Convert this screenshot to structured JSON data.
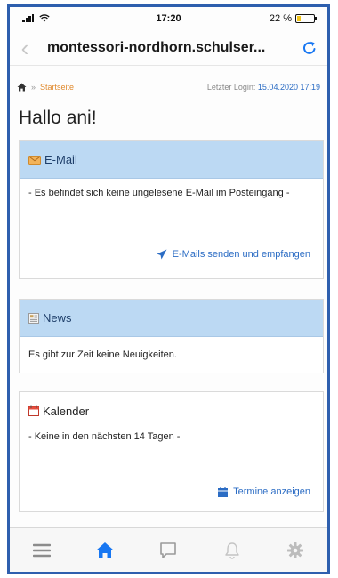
{
  "status_bar": {
    "time": "17:20",
    "battery_text": "22 %",
    "battery_level": 0.22
  },
  "browser": {
    "url": "montessori-nordhorn.schulser..."
  },
  "breadcrumb": {
    "home_link": "Startseite",
    "last_login_label": "Letzter Login:",
    "last_login_value": "15.04.2020 17:19"
  },
  "greeting": "Hallo ani!",
  "email_panel": {
    "title": "E-Mail",
    "message": "- Es befindet sich keine ungelesene E-Mail im Posteingang -",
    "action_label": "E-Mails senden und empfangen"
  },
  "news_panel": {
    "title": "News",
    "message": "Es gibt zur Zeit keine Neuigkeiten."
  },
  "calendar_panel": {
    "title": "Kalender",
    "message": "- Keine in den nächsten 14 Tagen -",
    "action_label": "Termine anzeigen"
  },
  "tab_bar": {
    "items": [
      "menu-icon",
      "home-icon",
      "chat-icon",
      "bell-icon",
      "gear-icon"
    ],
    "active": "home-icon"
  },
  "colors": {
    "frame": "#2e5fae",
    "panel_header": "#bcd9f3",
    "link": "#2b6cc4",
    "breadcrumb_link": "#e08a2e",
    "active_tab": "#1877f2"
  }
}
